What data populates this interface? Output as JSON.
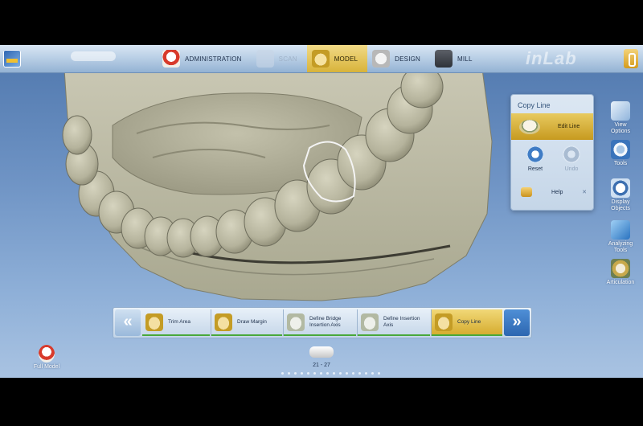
{
  "colors": {
    "accent": "#d8b33a",
    "progress": "#48a83a"
  },
  "topbar": {
    "brand": "inLab",
    "steps": [
      {
        "label": "ADMINISTRATION",
        "icon": "administration-icon",
        "state": "normal"
      },
      {
        "label": "SCAN",
        "icon": "scan-icon",
        "state": "disabled"
      },
      {
        "label": "MODEL",
        "icon": "model-icon",
        "state": "active"
      },
      {
        "label": "DESIGN",
        "icon": "design-icon",
        "state": "normal"
      },
      {
        "label": "MILL",
        "icon": "mill-icon",
        "state": "normal"
      }
    ]
  },
  "panel": {
    "title": "Copy Line",
    "edit_label": "Edit Line",
    "reset_label": "Reset",
    "undo_label": "Undo",
    "help_label": "Help",
    "close_glyph": "✕"
  },
  "right_toolbar": [
    {
      "label": "View\nOptions",
      "icon": "view-options-icon"
    },
    {
      "label": "Tools",
      "icon": "tools-icon"
    },
    {
      "label": "Display\nObjects",
      "icon": "display-objects-icon"
    },
    {
      "label": "Analyzing\nTools",
      "icon": "analyzing-tools-icon"
    },
    {
      "label": "Articulation",
      "icon": "articulation-icon"
    }
  ],
  "workflow": {
    "prev_glyph": "«",
    "next_glyph": "»",
    "steps": [
      {
        "label": "Trim Area",
        "state": "done"
      },
      {
        "label": "Draw Margin",
        "state": "done"
      },
      {
        "label": "Define Bridge\nInsertion Axis",
        "state": "done"
      },
      {
        "label": "Define Insertion\nAxis",
        "state": "done"
      },
      {
        "label": "Copy Line",
        "state": "active"
      }
    ]
  },
  "bottom": {
    "full_model_label": "Full Model",
    "case_label": "21 - 27",
    "page_dots": 16
  }
}
